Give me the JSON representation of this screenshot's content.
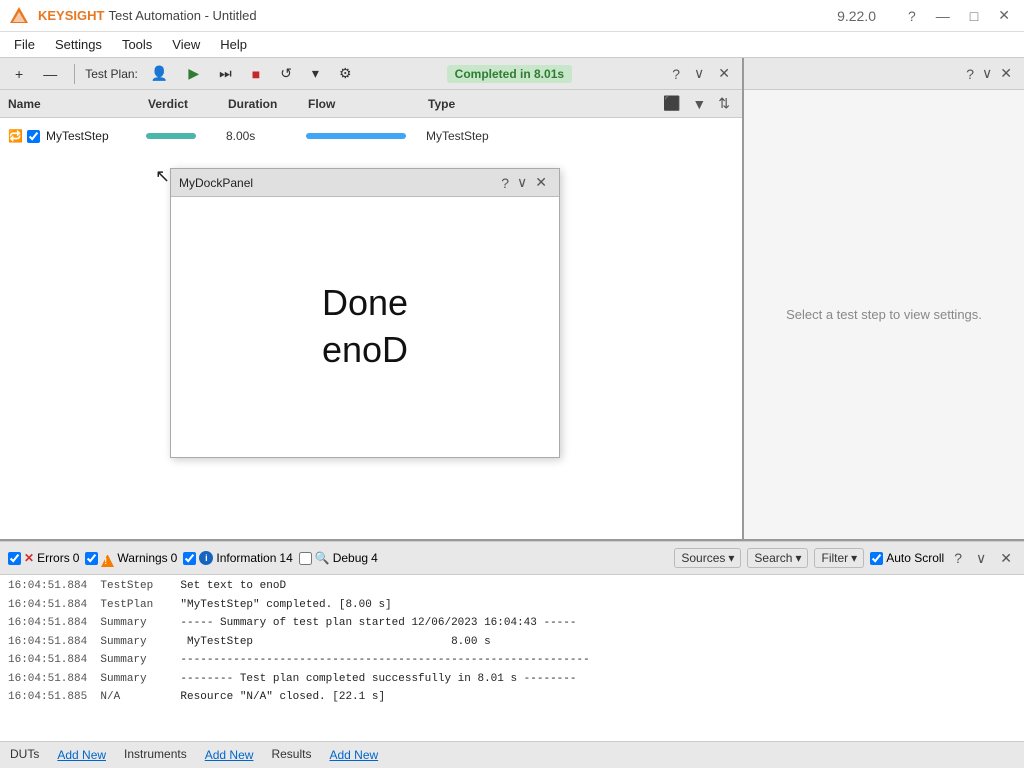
{
  "app": {
    "brand": "KEYSIGHT",
    "title": "Test Automation - Untitled",
    "version": "9.22.0"
  },
  "title_bar": {
    "help_btn": "?",
    "minimize_btn": "—",
    "maximize_btn": "□",
    "close_btn": "✕"
  },
  "menu": {
    "items": [
      "File",
      "Settings",
      "Tools",
      "View",
      "Help"
    ]
  },
  "test_plan_panel": {
    "help_btn": "?",
    "minimize_btn": "∨",
    "close_btn": "✕",
    "toolbar": {
      "add_btn": "+",
      "remove_btn": "—",
      "label": "Test Plan:",
      "avatar_btn": "👤",
      "play_btn": "▶",
      "skip_btn": "⏭",
      "stop_btn": "■",
      "refresh_btn": "↺",
      "dropdown_btn": "▾",
      "settings_btn": "⚙"
    },
    "status": "Completed in 8.01s",
    "columns": {
      "name": "Name",
      "verdict": "Verdict",
      "duration": "Duration",
      "flow": "Flow",
      "type": "Type"
    },
    "rows": [
      {
        "name": "MyTestStep",
        "verdict": "",
        "duration": "8.00s",
        "flow": "",
        "type": "MyTestStep"
      }
    ]
  },
  "dock_panel": {
    "title": "MyDockPanel",
    "help_btn": "?",
    "minimize_btn": "∨",
    "close_btn": "✕",
    "line1": "Done",
    "line2": "enoD"
  },
  "settings_panel": {
    "help_btn": "?",
    "minimize_btn": "∨",
    "close_btn": "✕",
    "placeholder_text": "Select a test step to view settings."
  },
  "log_panel": {
    "help_btn": "?",
    "minimize_btn": "∨",
    "close_btn": "✕",
    "filters": {
      "errors": {
        "label": "Errors",
        "count": "0",
        "checked": true
      },
      "warnings": {
        "label": "Warnings",
        "count": "0",
        "checked": true
      },
      "information": {
        "label": "Information",
        "count": "14",
        "checked": true
      },
      "debug": {
        "label": "Debug",
        "count": "4",
        "checked": false
      }
    },
    "sources_btn": "Sources",
    "search_btn": "Search",
    "filter_btn": "Filter",
    "auto_scroll_label": "Auto Scroll",
    "auto_scroll_checked": true,
    "log_entries": [
      {
        "time": "16:04:51.884",
        "source": "TestStep",
        "message": "Set text to enoD"
      },
      {
        "time": "16:04:51.884",
        "source": "TestPlan",
        "message": "\"MyTestStep\" completed. [8.00 s]"
      },
      {
        "time": "16:04:51.884",
        "source": "Summary",
        "message": "----- Summary of test plan started 12/06/2023 16:04:43 -----"
      },
      {
        "time": "16:04:51.884",
        "source": "Summary",
        "message": " MyTestStep                              8.00 s"
      },
      {
        "time": "16:04:51.884",
        "source": "Summary",
        "message": "--------------------------------------------------------------"
      },
      {
        "time": "16:04:51.884",
        "source": "Summary",
        "message": "-------- Test plan completed successfully in 8.01 s --------"
      },
      {
        "time": "16:04:51.885",
        "source": "N/A",
        "message": "Resource \"N/A\" closed. [22.1 s]"
      }
    ]
  },
  "bottom_tabs": {
    "tabs": [
      {
        "label": "DUTs"
      },
      {
        "label": "Instruments"
      },
      {
        "label": "Results"
      }
    ],
    "add_new_label": "Add New"
  }
}
